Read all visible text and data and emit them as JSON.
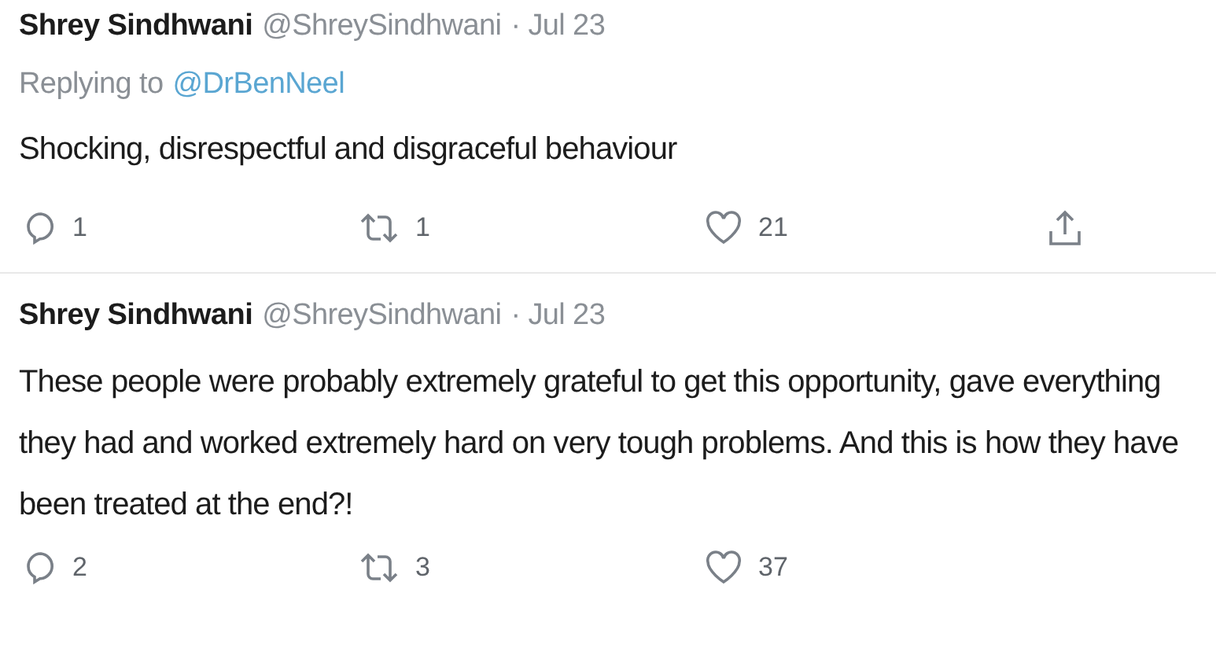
{
  "tweets": [
    {
      "name": "Shrey Sindhwani",
      "handle": "@ShreySindhwani",
      "date": "· Jul 23",
      "replying_label": "Replying to",
      "replying_to": "@DrBenNeel",
      "text": "Shocking, disrespectful and disgraceful behaviour",
      "actions": [
        {
          "kind": "reply",
          "count": "1"
        },
        {
          "kind": "retweet",
          "count": "1"
        },
        {
          "kind": "like",
          "count": "21"
        },
        {
          "kind": "share"
        }
      ]
    },
    {
      "name": "Shrey Sindhwani",
      "handle": "@ShreySindhwani",
      "date": "· Jul 23",
      "text": "These people were probably extremely grateful to get this opportunity, gave everything they had and worked extremely hard on very tough problems. And this is how they have been treated at the end?!",
      "actions": [
        {
          "kind": "reply",
          "count": "2"
        },
        {
          "kind": "retweet",
          "count": "3"
        },
        {
          "kind": "like",
          "count": "37"
        }
      ]
    }
  ]
}
